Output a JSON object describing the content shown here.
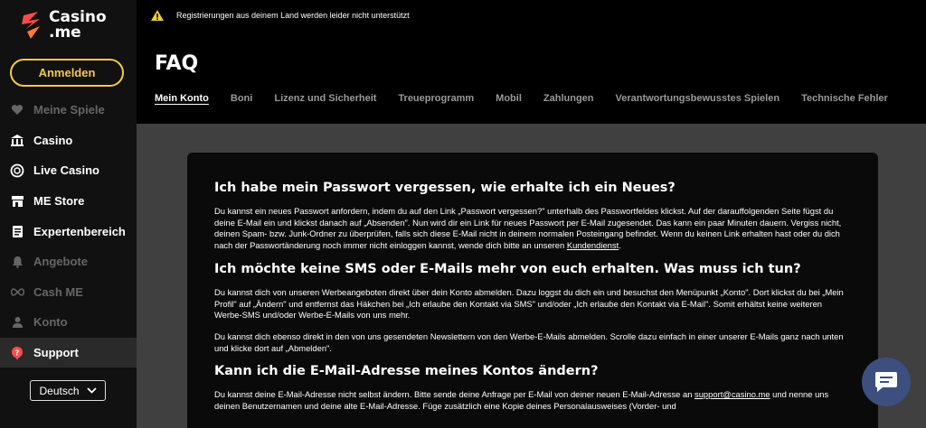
{
  "brand": {
    "line1": "Casino",
    "line2": ".me",
    "colors": {
      "accent": "#f2c94c",
      "logo": "#ff4b4b"
    }
  },
  "sidebar": {
    "login_label": "Anmelden",
    "items": [
      {
        "label": "Meine Spiele",
        "icon": "heart-icon",
        "disabled": true
      },
      {
        "label": "Casino",
        "icon": "casino-icon",
        "disabled": false
      },
      {
        "label": "Live Casino",
        "icon": "chip-icon",
        "disabled": false
      },
      {
        "label": "ME Store",
        "icon": "store-icon",
        "disabled": false
      },
      {
        "label": "Expertenbereich",
        "icon": "document-icon",
        "disabled": false
      },
      {
        "label": "Angebote",
        "icon": "bell-icon",
        "disabled": true
      },
      {
        "label": "Cash ME",
        "icon": "infinity-icon",
        "disabled": true
      },
      {
        "label": "Konto",
        "icon": "user-icon",
        "disabled": true
      },
      {
        "label": "Support",
        "icon": "support-icon",
        "disabled": false,
        "active": true
      }
    ],
    "language": "Deutsch"
  },
  "warning": {
    "text": "Registrierungen aus deinem Land werden leider nicht unterstützt",
    "icon": "warning-icon"
  },
  "header": {
    "title": "FAQ",
    "tabs": [
      "Mein Konto",
      "Boni",
      "Lizenz und Sicherheit",
      "Treueprogramm",
      "Mobil",
      "Zahlungen",
      "Verantwortungsbewusstes Spielen",
      "Technische Fehler"
    ]
  },
  "faq": [
    {
      "question": "Ich habe mein Passwort vergessen, wie erhalte ich ein Neues?",
      "answer": "Du kannst ein neues Passwort anfordern, indem du auf den Link „Passwort vergessen?\" unterhalb des Passwortfeldes klickst. Auf der darauffolgenden Seite fügst du deine E-Mail ein und klickst danach auf „Absenden\". Nun wird dir ein Link für neues Passwort per E-Mail zugesendet. Das kann ein paar Minuten dauern. Vergiss nicht, deinen Spam- bzw. Junk-Ordner zu überprüfen, falls sich diese E-Mail nicht in deinem normalen Posteingang befindet. Wenn du keinen Link erhalten hast oder du dich nach der Passwortänderung noch immer nicht einloggen kannst, wende dich bitte an unseren ",
      "link": "Kundendienst",
      "answer_end": "."
    },
    {
      "question": "Ich möchte keine SMS oder E-Mails mehr von euch erhalten. Was muss ich tun?",
      "answer": "Du kannst dich von unseren Werbeangeboten direkt über dein Konto abmelden. Dazu loggst du dich ein und besuchst den Menüpunkt „Konto\". Dort klickst du bei „Mein Profil\" auf „Ändern\" und entfernst das Häkchen bei „Ich erlaube den Kontakt via SMS\" und/oder „Ich erlaube den Kontakt via E-Mail\". Somit erhältst keine weiteren Werbe-SMS und/oder Werbe-E-Mails von uns mehr.",
      "answer2": "Du kannst dich ebenso direkt in den von uns gesendeten Newslettern von den Werbe-E-Mails abmelden. Scrolle dazu einfach in einer unserer E-Mails ganz nach unten und klicke dort auf „Abmelden\"."
    },
    {
      "question": "Kann ich die E-Mail-Adresse meines Kontos ändern?",
      "answer": "Du kannst deine E-Mail-Adresse nicht selbst ändern. Bitte sende deine Anfrage per E-Mail von deiner neuen E-Mail-Adresse an ",
      "link": "support@casino.me",
      "answer_end": " und nenne uns deinen Benutzernamen und deine alte E-Mail-Adresse. Füge zusätzlich eine Kopie deines Personalausweises (Vorder- und"
    }
  ],
  "chat": {
    "icon": "chat-icon"
  }
}
